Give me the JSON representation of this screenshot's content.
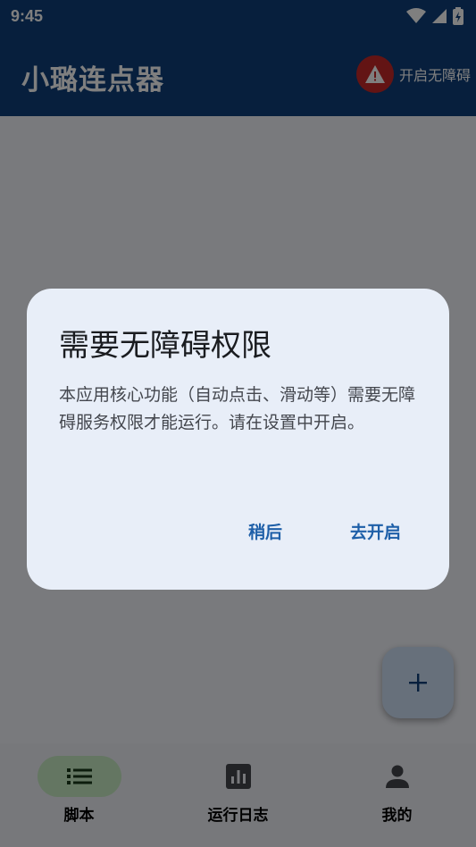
{
  "status_bar": {
    "time": "9:45"
  },
  "app_bar": {
    "title": "小璐连点器",
    "accessibility_button_label": "开启无障碍"
  },
  "bottom_nav": {
    "items": [
      {
        "label": "脚本",
        "icon": "list-icon",
        "active": true
      },
      {
        "label": "运行日志",
        "icon": "bar-chart-icon",
        "active": false
      },
      {
        "label": "我的",
        "icon": "person-icon",
        "active": false
      }
    ]
  },
  "fab": {
    "icon": "plus-icon"
  },
  "dialog": {
    "title": "需要无障碍权限",
    "body": "本应用核心功能（自动点击、滑动等）需要无障碍服务权限才能运行。请在设置中开启。",
    "later_label": "稍后",
    "open_label": "去开启"
  },
  "colors": {
    "app_bar": "#0e3f7a",
    "warning": "#c62828",
    "accent": "#1e5fa8",
    "nav_active_pill": "#c9ecc4",
    "dialog_surface": "#e8eef8"
  }
}
